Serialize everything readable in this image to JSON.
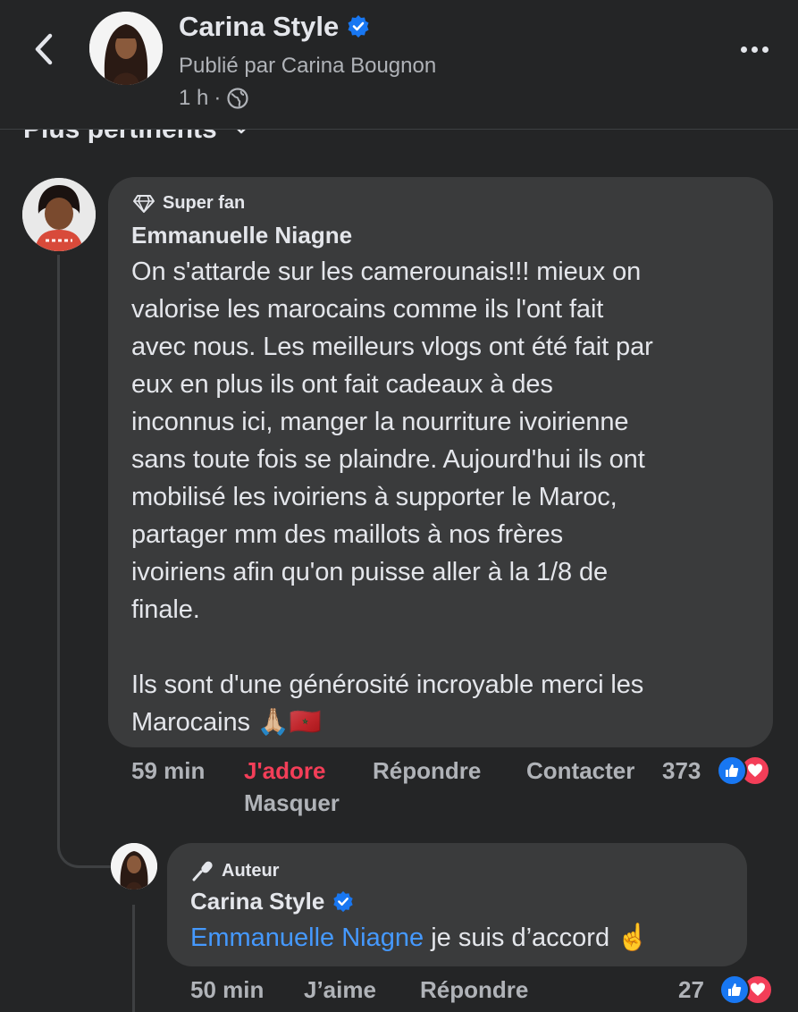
{
  "header": {
    "page_name": "Carina Style",
    "published_by": "Publié par Carina Bougnon",
    "time": "1 h",
    "separator": "·",
    "icons": {
      "back": "back-chevron-icon",
      "verified": "verified-badge-icon",
      "audience": "globe-icon",
      "more": "more-options-icon"
    }
  },
  "sort": {
    "label": "Plus pertinents",
    "icon": "chevron-down-icon"
  },
  "comments": [
    {
      "badge": "Super fan",
      "badge_icon": "diamond-icon",
      "author": "Emmanuelle Niagne",
      "text": "On s'attarde sur les camerounais!!! mieux on\nvalorise les marocains comme ils l'ont fait\navec nous. Les meilleurs vlogs ont été fait par\neux en plus ils ont fait cadeaux à des\ninconnus ici, manger la nourriture ivoirienne\nsans toute fois se plaindre. Aujourd'hui ils ont\nmobilisé les ivoiriens à supporter le Maroc,\npartager mm des maillots à nos frères\nivoiriens afin qu'on puisse aller à la 1/8 de\nfinale.\n\nIls sont d'une générosité incroyable merci les\nMarocains 🙏🏼🇲🇦",
      "time": "59 min",
      "reaction_label": "J'adore",
      "reply_label": "Répondre",
      "contact_label": "Contacter",
      "hide_label": "Masquer",
      "reaction_count": "373",
      "reaction_icons": [
        "like-icon",
        "love-icon"
      ],
      "colors": {
        "reacted": "#f33e58"
      }
    }
  ],
  "reply": {
    "badge": "Auteur",
    "badge_icon": "microphone-icon",
    "author": "Carina Style",
    "mention": "Emmanuelle Niagne",
    "text": " je suis d’accord ☝️",
    "time": "50 min",
    "like_label": "J’aime",
    "reply_label": "Répondre",
    "reaction_count": "27",
    "reaction_icons": [
      "like-icon",
      "love-icon"
    ],
    "colors": {
      "mention": "#4599ff"
    }
  }
}
